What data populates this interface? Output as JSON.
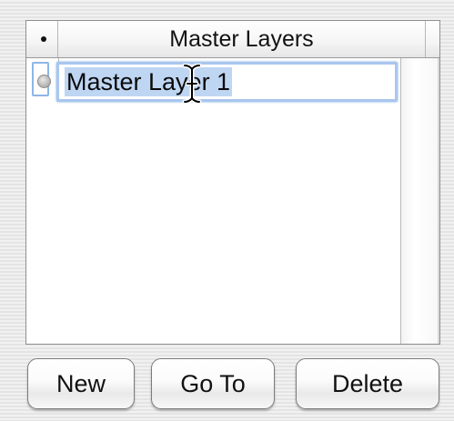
{
  "table": {
    "header": {
      "dot_column_glyph": "•",
      "name_column_label": "Master Layers"
    },
    "rows": [
      {
        "name": "Master Layer 1",
        "editing": true,
        "name_selected": true
      }
    ]
  },
  "buttons": {
    "new_label": "New",
    "goto_label": "Go To",
    "delete_label": "Delete"
  },
  "icons": {
    "header_dot": "bullet-icon",
    "row_marker": "radio-icon",
    "cursor": "ibeam-cursor-icon"
  },
  "colors": {
    "selection_highlight": "#bfd6f3",
    "focus_ring": "#a9c6ee"
  }
}
